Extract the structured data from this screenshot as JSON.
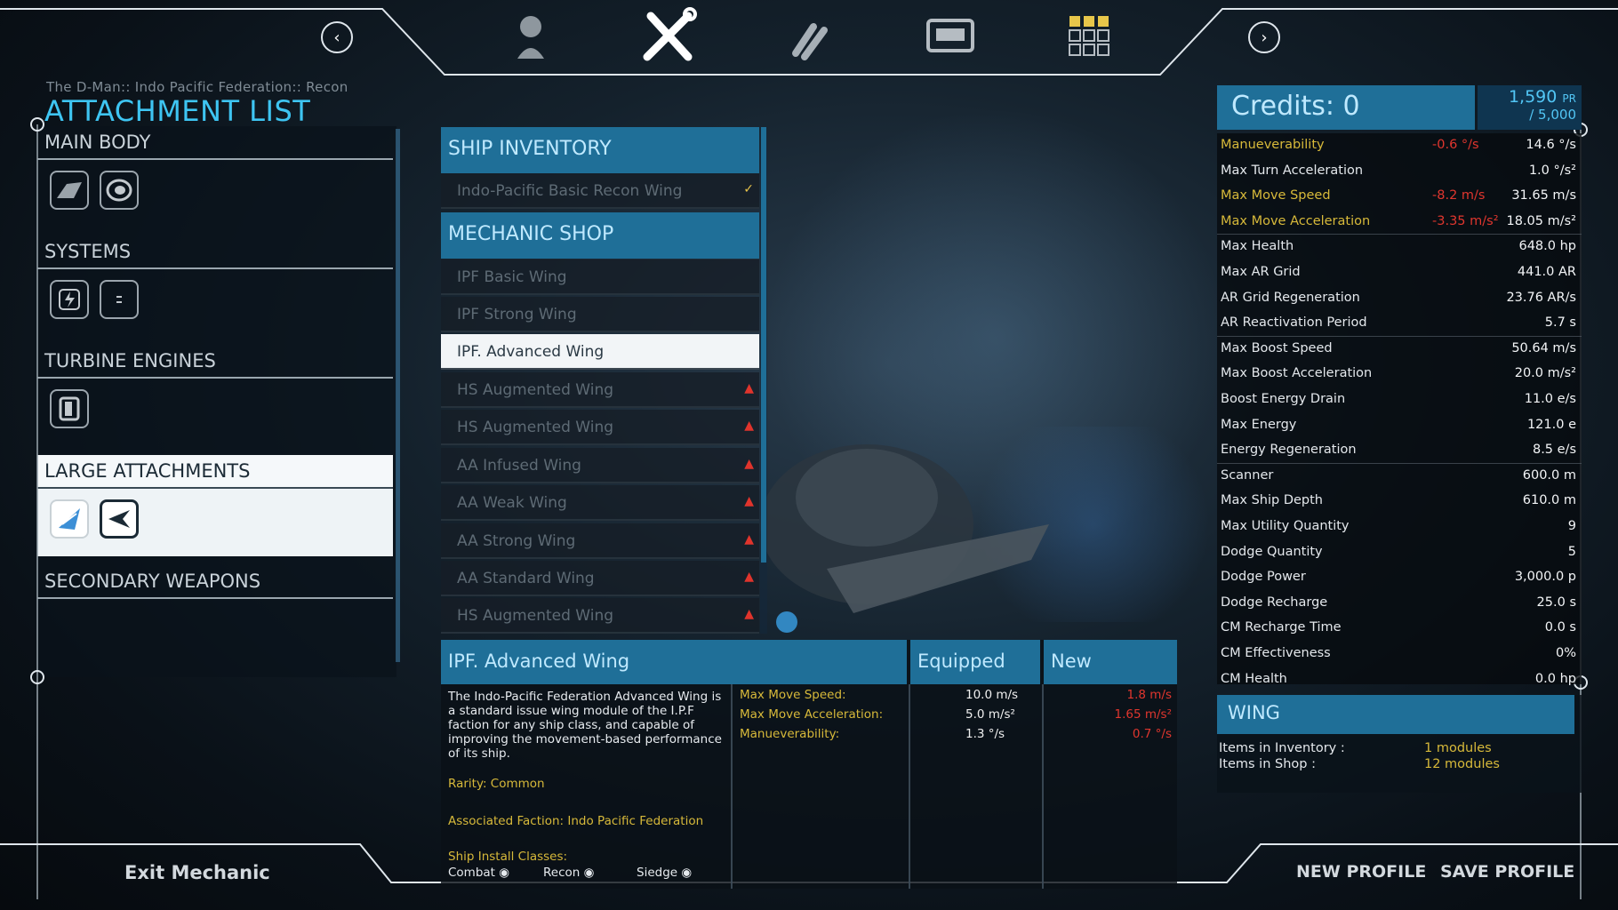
{
  "breadcrumb": "The D-Man::  Indo Pacific Federation::  Recon",
  "title": "ATTACHMENT LIST",
  "nav": {
    "prev_icon": "chevron-left-icon",
    "next_icon": "chevron-right-icon",
    "tabs": [
      "pilot-icon",
      "wrench-icon",
      "ammo-icon",
      "cargo-icon",
      "grid-icon"
    ],
    "active_tab": "wrench-icon"
  },
  "categories": [
    {
      "label": "MAIN BODY",
      "slots": [
        "hull-icon",
        "cockpit-icon"
      ]
    },
    {
      "label": "SYSTEMS",
      "slots": [
        "power-system-icon",
        "sensor-icon"
      ]
    },
    {
      "label": "TURBINE ENGINES",
      "slots": [
        "engine-icon"
      ]
    },
    {
      "label": "LARGE ATTACHMENTS",
      "slots": [
        "wing-icon",
        "claw-icon"
      ],
      "selected": true
    },
    {
      "label": "SECONDARY WEAPONS",
      "slots": []
    }
  ],
  "inventory": {
    "header": "SHIP INVENTORY",
    "items": [
      {
        "label": "Indo-Pacific Basic Recon Wing",
        "flag": "check"
      }
    ]
  },
  "shop": {
    "header": "MECHANIC SHOP",
    "items": [
      {
        "label": "IPF Basic Wing",
        "flag": ""
      },
      {
        "label": "IPF Strong Wing",
        "flag": ""
      },
      {
        "label": "IPF. Advanced Wing",
        "flag": "",
        "selected": true
      },
      {
        "label": "HS Augmented Wing",
        "flag": "warn"
      },
      {
        "label": "HS Augmented Wing",
        "flag": "warn"
      },
      {
        "label": "AA Infused Wing",
        "flag": "warn"
      },
      {
        "label": "AA Weak Wing",
        "flag": "warn"
      },
      {
        "label": "AA Strong Wing",
        "flag": "warn"
      },
      {
        "label": "AA Standard Wing",
        "flag": "warn"
      },
      {
        "label": "HS Augmented Wing",
        "flag": "warn"
      }
    ]
  },
  "detail": {
    "name": "IPF. Advanced Wing",
    "equipped_header": "Equipped",
    "new_header": "New",
    "description": "The Indo-Pacific Federation Advanced Wing is a standard issue wing module of the I.P.F faction for any ship class, and capable of improving the movement-based performance of its ship.",
    "rarity": "Rarity: Common",
    "faction": "Associated Faction: Indo Pacific Federation",
    "install_label": "Ship Install Classes:",
    "classes": [
      "Combat",
      "Recon",
      "Siedge"
    ],
    "stats": [
      {
        "name": "Max Move Speed:",
        "equipped": "10.0 m/s",
        "new": "1.8 m/s"
      },
      {
        "name": "Max Move Acceleration:",
        "equipped": "5.0 m/s²",
        "new": "1.65 m/s²"
      },
      {
        "name": "Manueverability:",
        "equipped": "1.3 °/s",
        "new": "0.7 °/s"
      }
    ]
  },
  "credits": {
    "label": "Credits: 0",
    "pr_current": "1,590",
    "pr_unit": "PR",
    "pr_max": "/ 5,000"
  },
  "ship_stats": [
    {
      "name": "Manueverability",
      "delta": "-0.6 °/s",
      "value": "14.6 °/s",
      "mod": true
    },
    {
      "name": "Max Turn Acceleration",
      "delta": "",
      "value": "1.0 °/s²"
    },
    {
      "name": "Max Move Speed",
      "delta": "-8.2 m/s",
      "value": "31.65 m/s",
      "mod": true
    },
    {
      "name": "Max Move Acceleration",
      "delta": "-3.35 m/s²",
      "value": "18.05 m/s²",
      "mod": true
    },
    {
      "name": "Max Health",
      "delta": "",
      "value": "648.0 hp"
    },
    {
      "name": "Max AR Grid",
      "delta": "",
      "value": "441.0 AR"
    },
    {
      "name": "AR Grid Regeneration",
      "delta": "",
      "value": "23.76 AR/s"
    },
    {
      "name": "AR Reactivation Period",
      "delta": "",
      "value": "5.7 s"
    },
    {
      "name": "Max Boost Speed",
      "delta": "",
      "value": "50.64 m/s"
    },
    {
      "name": "Max Boost Acceleration",
      "delta": "",
      "value": "20.0 m/s²"
    },
    {
      "name": "Boost Energy Drain",
      "delta": "",
      "value": "11.0 e/s"
    },
    {
      "name": "Max Energy",
      "delta": "",
      "value": "121.0 e"
    },
    {
      "name": "Energy Regeneration",
      "delta": "",
      "value": "8.5 e/s"
    },
    {
      "name": "Scanner",
      "delta": "",
      "value": "600.0 m"
    },
    {
      "name": "Max Ship Depth",
      "delta": "",
      "value": "610.0 m"
    },
    {
      "name": "Max Utility Quantity",
      "delta": "",
      "value": "9"
    },
    {
      "name": "Dodge Quantity",
      "delta": "",
      "value": "5"
    },
    {
      "name": "Dodge Power",
      "delta": "",
      "value": "3,000.0 p"
    },
    {
      "name": "Dodge Recharge",
      "delta": "",
      "value": "25.0 s"
    },
    {
      "name": "CM Recharge Time",
      "delta": "",
      "value": "0.0 s"
    },
    {
      "name": "CM Effectiveness",
      "delta": "",
      "value": "0%"
    },
    {
      "name": "CM Health",
      "delta": "",
      "value": "0.0 hp"
    }
  ],
  "wing": {
    "header": "WING",
    "inventory_label": "Items in Inventory :",
    "inventory_value": "1 modules",
    "shop_label": "Items in Shop :",
    "shop_value": "12 modules"
  },
  "bottom": {
    "exit": "Exit Mechanic",
    "new_profile": "NEW PROFILE",
    "save_profile": "SAVE PROFILE"
  },
  "colors": {
    "accent": "#1f6f98",
    "title": "#3ec5f2",
    "highlight": "#d7b93a",
    "negative": "#e0362e"
  }
}
